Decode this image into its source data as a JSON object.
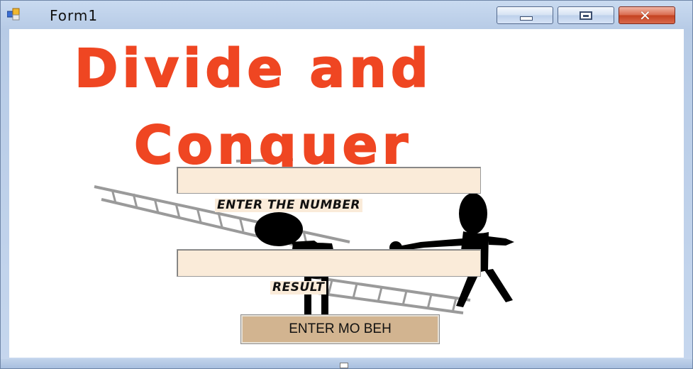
{
  "window": {
    "title": "Form1",
    "buttons": [
      "minimize-icon",
      "maximize-icon",
      "close-icon"
    ]
  },
  "banner": {
    "line1": "Divide and",
    "line2": "Conquer"
  },
  "form": {
    "number_input_value": "",
    "number_label": "ENTER THE NUMBER",
    "result_value": "",
    "result_label": "RESULT",
    "submit_label": "ENTER MO BEH"
  },
  "colors": {
    "banner": "#ef4622",
    "field_bg": "#faebd9",
    "button_bg": "#d2b490"
  }
}
